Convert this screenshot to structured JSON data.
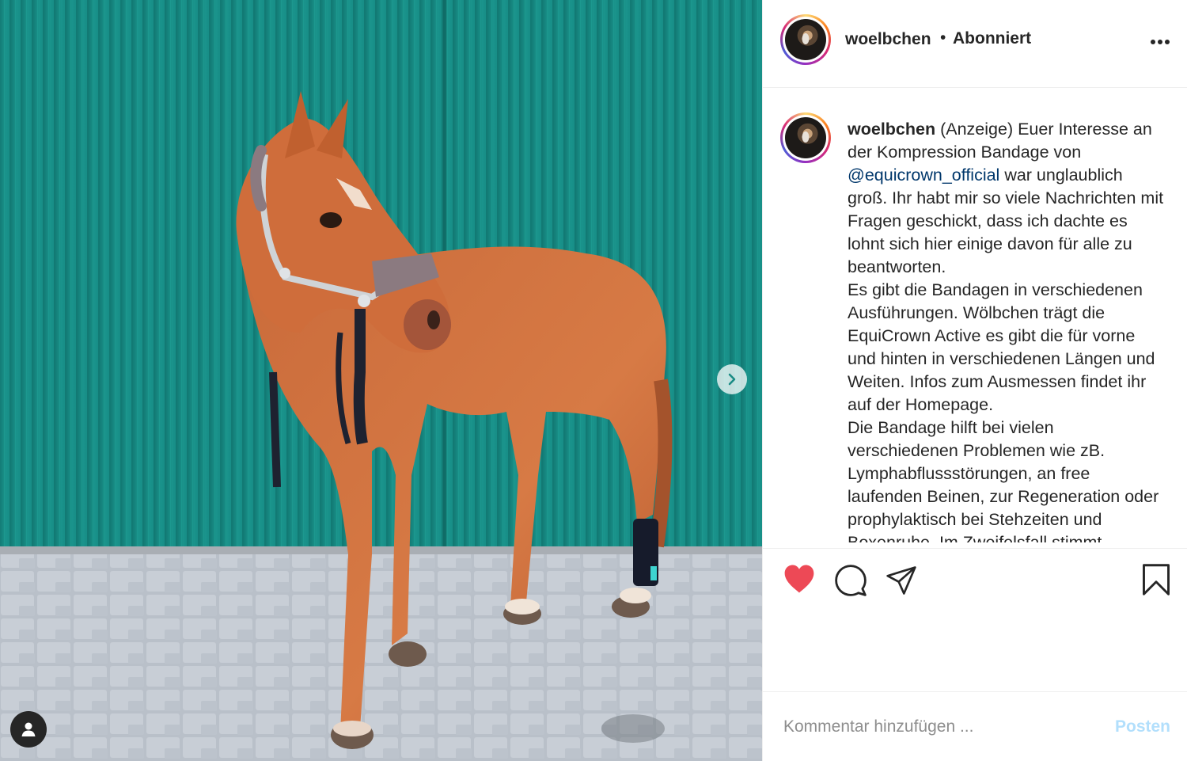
{
  "post": {
    "username": "woelbchen",
    "separator": "•",
    "follow_status": "Abonniert",
    "caption_username": "woelbchen",
    "caption_intro": " (Anzeige) Euer Interesse an der Kompression Bandage von ",
    "mention": "@equicrown_official",
    "caption_rest": " war unglaublich groß. Ihr habt mir so viele Nachrichten mit Fragen geschickt, dass ich dachte es lohnt sich hier einige davon für alle zu beantworten.",
    "caption_p2": "Es gibt die Bandagen in verschiedenen Ausführungen. Wölbchen trägt die EquiCrown Active es gibt die für vorne und hinten in verschiedenen Längen und Weiten. Infos zum Ausmessen findet ihr auf der Homepage.",
    "caption_p3": "Die Bandage hilft bei vielen verschiedenen Problemen wie zB. Lymphabflussstörungen, an free laufenden Beinen, zur Regeneration oder prophylaktisch bei Stehzeiten und Boxenruhe. Im Zweifelsfall stimmt"
  },
  "comment": {
    "placeholder": "Kommentar hinzufügen ...",
    "post_label": "Posten"
  },
  "icons": {
    "like": "heart-icon",
    "comment": "comment-icon",
    "share": "share-icon",
    "save": "bookmark-icon",
    "more": "more-options-icon",
    "next": "chevron-right-icon",
    "tag": "user-tag-icon"
  },
  "colors": {
    "like_active": "#ed4956",
    "mention": "#00376b",
    "post_button": "#b2dffc",
    "wall": "#1a8c85"
  }
}
